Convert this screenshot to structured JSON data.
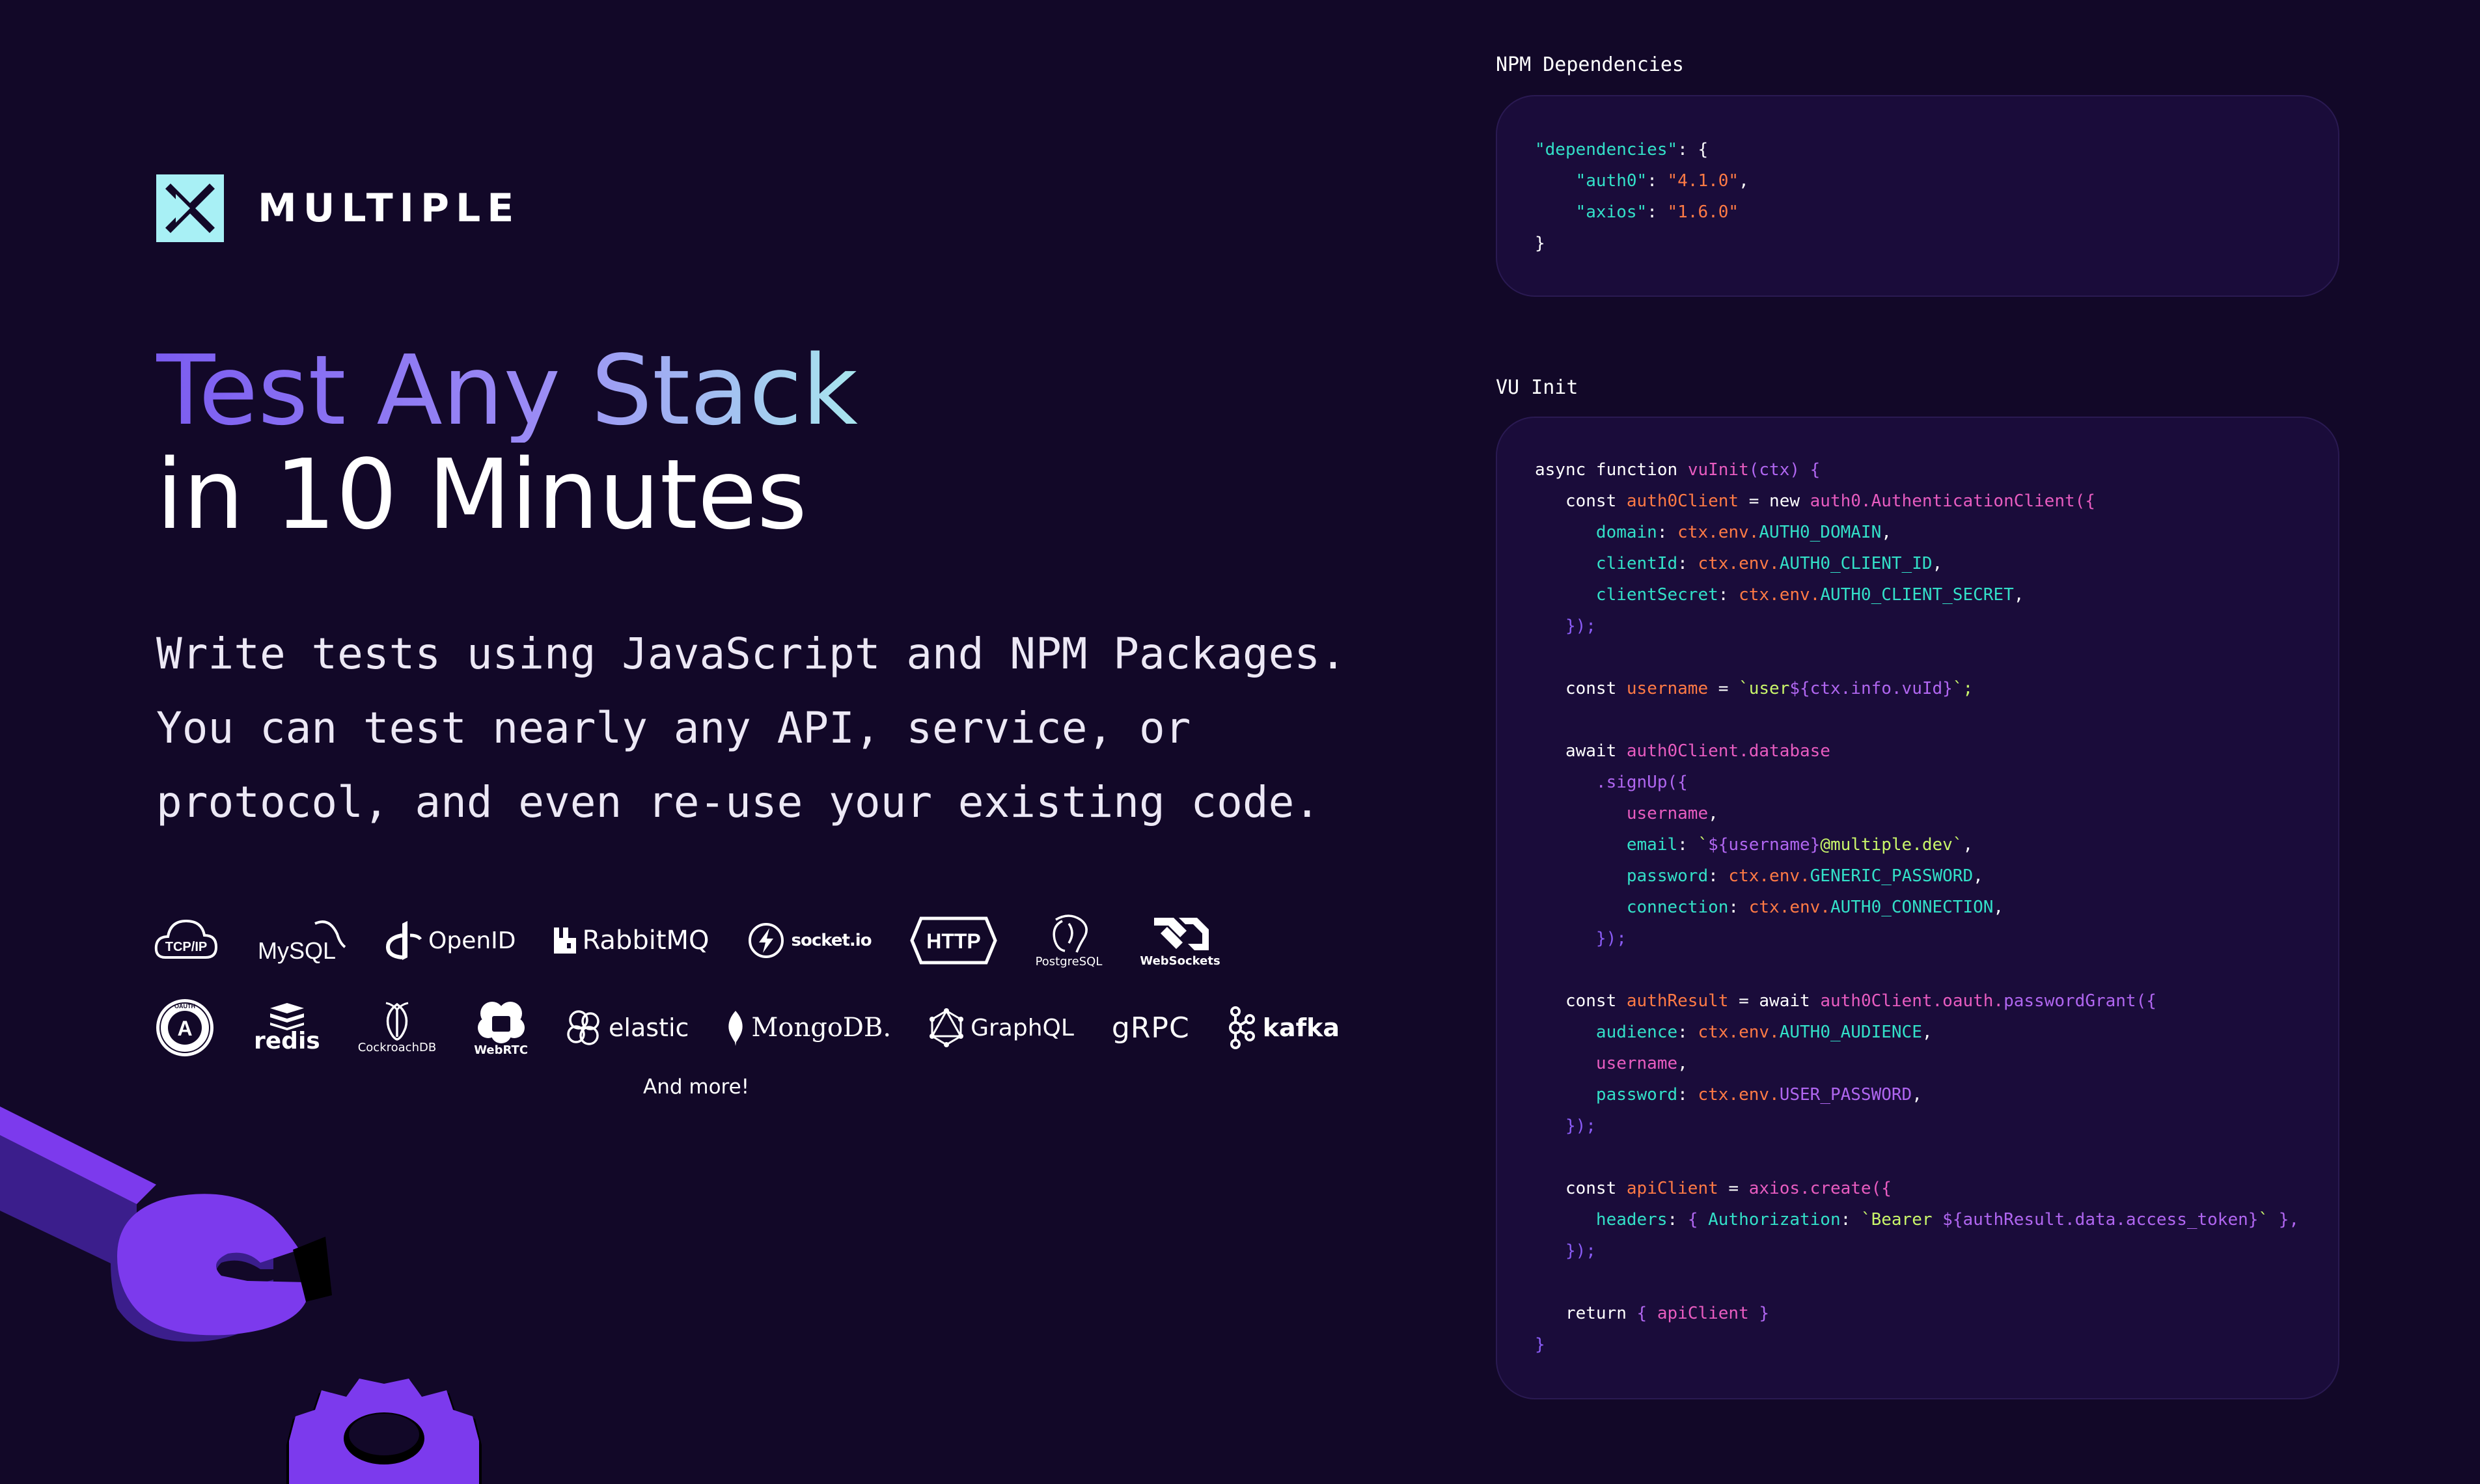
{
  "brand": {
    "name": "MULTIPLE",
    "mark_color": "#a8f0f5"
  },
  "hero": {
    "headline_line1": "Test Any Stack",
    "headline_line2": "in 10 Minutes",
    "description_lines": [
      "Write tests using JavaScript and NPM Packages.",
      "You can test nearly any API, service, or",
      "protocol, and even re-use your existing code."
    ]
  },
  "integrations": {
    "row1": [
      {
        "icon": "tcp-ip-icon",
        "label": "TCP/IP"
      },
      {
        "icon": "mysql-icon",
        "label": "MySQL"
      },
      {
        "icon": "openid-icon",
        "label": "OpenID"
      },
      {
        "icon": "rabbitmq-icon",
        "label": "RabbitMQ"
      },
      {
        "icon": "socketio-icon",
        "label": "socket.io"
      },
      {
        "icon": "http-icon",
        "label": "HTTP"
      },
      {
        "icon": "postgresql-icon",
        "label": "PostgreSQL"
      },
      {
        "icon": "websockets-icon",
        "label": "WebSockets"
      }
    ],
    "row2": [
      {
        "icon": "oauth-icon",
        "label": "OAUTH",
        "sublabel": "A"
      },
      {
        "icon": "redis-icon",
        "label": "redis"
      },
      {
        "icon": "cockroachdb-icon",
        "label": "CockroachDB"
      },
      {
        "icon": "webrtc-icon",
        "label": "WebRTC"
      },
      {
        "icon": "elastic-icon",
        "label": "elastic"
      },
      {
        "icon": "mongodb-icon",
        "label": "MongoDB."
      },
      {
        "icon": "graphql-icon",
        "label": "GraphQL"
      },
      {
        "icon": "grpc-icon",
        "label": "gRPC"
      },
      {
        "icon": "kafka-icon",
        "label": "kafka"
      }
    ],
    "more_label": "And more!"
  },
  "panels": {
    "npm": {
      "label": "NPM Dependencies",
      "lines": [
        [
          {
            "t": "\"dependencies\"",
            "c": "t"
          },
          {
            "t": ": {",
            "c": "w"
          }
        ],
        [
          {
            "t": "    \"auth0\"",
            "c": "t"
          },
          {
            "t": ": ",
            "c": "w"
          },
          {
            "t": "\"4.1.0\"",
            "c": "o"
          },
          {
            "t": ",",
            "c": "w"
          }
        ],
        [
          {
            "t": "    \"axios\"",
            "c": "t"
          },
          {
            "t": ": ",
            "c": "w"
          },
          {
            "t": "\"1.6.0\"",
            "c": "o"
          }
        ],
        [
          {
            "t": "}",
            "c": "w"
          }
        ]
      ]
    },
    "vu": {
      "label": "VU Init",
      "lines": [
        [
          {
            "t": "async function ",
            "c": "w"
          },
          {
            "t": "vuInit",
            "c": "m"
          },
          {
            "t": "(ctx) {",
            "c": "p"
          }
        ],
        [
          {
            "t": "   const ",
            "c": "w"
          },
          {
            "t": "auth0Client",
            "c": "o"
          },
          {
            "t": " = new ",
            "c": "w"
          },
          {
            "t": "auth0.AuthenticationClient({",
            "c": "m"
          }
        ],
        [
          {
            "t": "      domain",
            "c": "t"
          },
          {
            "t": ": ",
            "c": "w"
          },
          {
            "t": "ctx.env.",
            "c": "o"
          },
          {
            "t": "AUTH0_DOMAIN",
            "c": "t"
          },
          {
            "t": ",",
            "c": "w"
          }
        ],
        [
          {
            "t": "      clientId",
            "c": "t"
          },
          {
            "t": ": ",
            "c": "w"
          },
          {
            "t": "ctx.env.",
            "c": "o"
          },
          {
            "t": "AUTH0_CLIENT_ID",
            "c": "t"
          },
          {
            "t": ",",
            "c": "w"
          }
        ],
        [
          {
            "t": "      clientSecret",
            "c": "t"
          },
          {
            "t": ": ",
            "c": "w"
          },
          {
            "t": "ctx.env.",
            "c": "o"
          },
          {
            "t": "AUTH0_CLIENT_SECRET",
            "c": "t"
          },
          {
            "t": ",",
            "c": "w"
          }
        ],
        [
          {
            "t": "   });",
            "c": "b"
          }
        ],
        [
          {
            "t": "",
            "c": "w"
          }
        ],
        [
          {
            "t": "   const ",
            "c": "w"
          },
          {
            "t": "username",
            "c": "o"
          },
          {
            "t": " = ",
            "c": "w"
          },
          {
            "t": "`user",
            "c": "g"
          },
          {
            "t": "${ctx.info.vuId}",
            "c": "p"
          },
          {
            "t": "`;",
            "c": "g"
          }
        ],
        [
          {
            "t": "",
            "c": "w"
          }
        ],
        [
          {
            "t": "   await ",
            "c": "w"
          },
          {
            "t": "auth0Client.database",
            "c": "m"
          }
        ],
        [
          {
            "t": "      .signUp({",
            "c": "p"
          }
        ],
        [
          {
            "t": "         username",
            "c": "m"
          },
          {
            "t": ",",
            "c": "w"
          }
        ],
        [
          {
            "t": "         email",
            "c": "t"
          },
          {
            "t": ": ",
            "c": "w"
          },
          {
            "t": "`",
            "c": "g"
          },
          {
            "t": "${username}",
            "c": "p"
          },
          {
            "t": "@multiple.dev`",
            "c": "g"
          },
          {
            "t": ",",
            "c": "w"
          }
        ],
        [
          {
            "t": "         password",
            "c": "t"
          },
          {
            "t": ": ",
            "c": "w"
          },
          {
            "t": "ctx.env.",
            "c": "o"
          },
          {
            "t": "GENERIC_PASSWORD",
            "c": "t"
          },
          {
            "t": ",",
            "c": "w"
          }
        ],
        [
          {
            "t": "         connection",
            "c": "t"
          },
          {
            "t": ": ",
            "c": "w"
          },
          {
            "t": "ctx.env.",
            "c": "o"
          },
          {
            "t": "AUTH0_CONNECTION",
            "c": "t"
          },
          {
            "t": ",",
            "c": "w"
          }
        ],
        [
          {
            "t": "      });",
            "c": "b"
          }
        ],
        [
          {
            "t": "",
            "c": "w"
          }
        ],
        [
          {
            "t": "   const ",
            "c": "w"
          },
          {
            "t": "authResult",
            "c": "o"
          },
          {
            "t": " = await ",
            "c": "w"
          },
          {
            "t": "auth0Client.oauth.",
            "c": "m"
          },
          {
            "t": "passwordGrant({",
            "c": "p"
          }
        ],
        [
          {
            "t": "      audience",
            "c": "t"
          },
          {
            "t": ": ",
            "c": "w"
          },
          {
            "t": "ctx.env.",
            "c": "o"
          },
          {
            "t": "AUTH0_AUDIENCE",
            "c": "t"
          },
          {
            "t": ",",
            "c": "w"
          }
        ],
        [
          {
            "t": "      username",
            "c": "m"
          },
          {
            "t": ",",
            "c": "w"
          }
        ],
        [
          {
            "t": "      password",
            "c": "t"
          },
          {
            "t": ": ",
            "c": "w"
          },
          {
            "t": "ctx.env.",
            "c": "o"
          },
          {
            "t": "USER_PASSWORD",
            "c": "p"
          },
          {
            "t": ",",
            "c": "w"
          }
        ],
        [
          {
            "t": "   });",
            "c": "b"
          }
        ],
        [
          {
            "t": "",
            "c": "w"
          }
        ],
        [
          {
            "t": "   const ",
            "c": "w"
          },
          {
            "t": "apiClient",
            "c": "o"
          },
          {
            "t": " = ",
            "c": "w"
          },
          {
            "t": "axios.create({",
            "c": "m"
          }
        ],
        [
          {
            "t": "      headers",
            "c": "t"
          },
          {
            "t": ": ",
            "c": "w"
          },
          {
            "t": "{ ",
            "c": "p"
          },
          {
            "t": "Authorization",
            "c": "t"
          },
          {
            "t": ": ",
            "c": "w"
          },
          {
            "t": "`Bearer ",
            "c": "g"
          },
          {
            "t": "${authResult.data.access_token}",
            "c": "p"
          },
          {
            "t": "` ",
            "c": "g"
          },
          {
            "t": "},",
            "c": "p"
          }
        ],
        [
          {
            "t": "   });",
            "c": "b"
          }
        ],
        [
          {
            "t": "",
            "c": "w"
          }
        ],
        [
          {
            "t": "   return ",
            "c": "w"
          },
          {
            "t": "{ ",
            "c": "p"
          },
          {
            "t": "apiClient",
            "c": "m"
          },
          {
            "t": " }",
            "c": "p"
          }
        ],
        [
          {
            "t": "}",
            "c": "b"
          }
        ]
      ]
    }
  }
}
